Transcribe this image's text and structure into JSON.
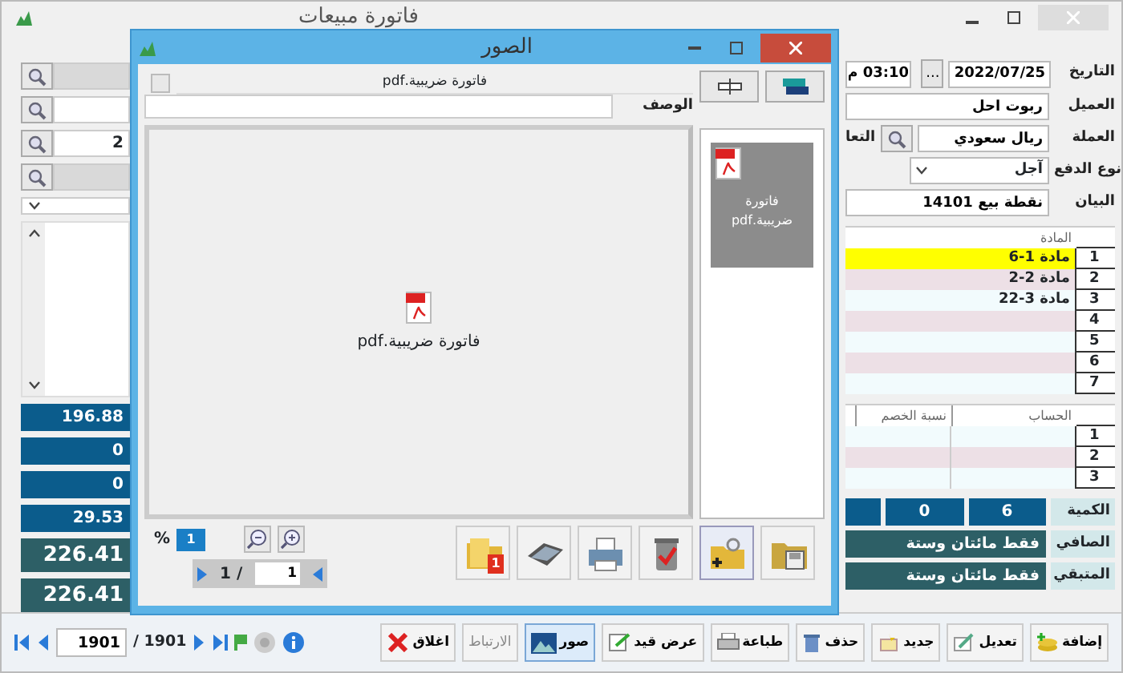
{
  "main_window": {
    "title": "فاتورة مبيعات"
  },
  "left_panel": {
    "lookup_value": "2",
    "totals": [
      {
        "value": "196.88",
        "kind": "small"
      },
      {
        "value": "0",
        "kind": "small"
      },
      {
        "value": "0",
        "kind": "small"
      },
      {
        "value": "29.53",
        "kind": "small"
      },
      {
        "value": "226.41",
        "kind": "large"
      },
      {
        "value": "226.41",
        "kind": "large"
      }
    ]
  },
  "form": {
    "fields": [
      {
        "label": "التاريخ",
        "kind": "date",
        "value": "2022/07/25",
        "button": "...",
        "time": "03:10 م"
      },
      {
        "label": "العميل",
        "kind": "text",
        "value": "ربوت احل"
      },
      {
        "label": "العملة",
        "kind": "lookup",
        "value": "ريال سعودي",
        "side_label": "التعا"
      },
      {
        "label": "نوع الدفع",
        "kind": "select",
        "value": "آجل"
      },
      {
        "label": "البيان",
        "kind": "text",
        "value": "نقطة بيع 14101"
      }
    ]
  },
  "items_table": {
    "columns": [
      "المادة"
    ],
    "rows": [
      {
        "number": "1",
        "item": "6-مادة 1",
        "selected": true
      },
      {
        "number": "2",
        "item": "2-مادة 2",
        "selected": false
      },
      {
        "number": "3",
        "item": "22-مادة 3",
        "selected": false
      },
      {
        "number": "4",
        "selected": false
      },
      {
        "number": "5",
        "selected": false
      },
      {
        "number": "6",
        "selected": false
      },
      {
        "number": "7",
        "selected": false
      }
    ]
  },
  "accounts_table": {
    "columns": [
      "الحساب",
      "نسبة الخصم"
    ],
    "rows": [
      {
        "number": "1"
      },
      {
        "number": "2"
      },
      {
        "number": "3"
      }
    ]
  },
  "summary": [
    {
      "label": "الكمية",
      "kind": "cells",
      "values": [
        "6",
        "0"
      ]
    },
    {
      "label": "الصافي",
      "kind": "words",
      "value": "فقط مائتان وستة"
    },
    {
      "label": "المتبقي",
      "kind": "words",
      "value": "فقط مائتان وستة"
    }
  ],
  "toolbar": [
    {
      "label": "إضافة",
      "selected": false,
      "disabled": false
    },
    {
      "label": "تعديل",
      "selected": false,
      "disabled": false
    },
    {
      "label": "جديد",
      "selected": false,
      "disabled": false
    },
    {
      "label": "حذف",
      "selected": false,
      "disabled": false
    },
    {
      "label": "طباعة",
      "selected": false,
      "disabled": false
    },
    {
      "label": "عرض قيد",
      "selected": false,
      "disabled": false
    },
    {
      "label": "صور",
      "selected": true,
      "disabled": false
    },
    {
      "label": "الارتباط",
      "selected": false,
      "disabled": true
    },
    {
      "label": "اغلاق",
      "selected": false,
      "disabled": false
    }
  ],
  "navigator": {
    "current": "1901",
    "separator": "/",
    "total": "1901"
  },
  "dialog": {
    "title": "الصور",
    "file_name": "فاتورة ضريبية.pdf",
    "description_label": "الوصف",
    "preview_caption": "فاتورة ضريبية.pdf",
    "checkbox": {
      "checked": false
    },
    "thumbnails": [
      {
        "caption": "فاتورة ضريبية.pdf",
        "selected": true
      }
    ],
    "zoom": {
      "value": "1",
      "unit": "%"
    },
    "pager": {
      "current": "1",
      "separator": "/",
      "total": "1"
    },
    "folder_badge": "1"
  }
}
